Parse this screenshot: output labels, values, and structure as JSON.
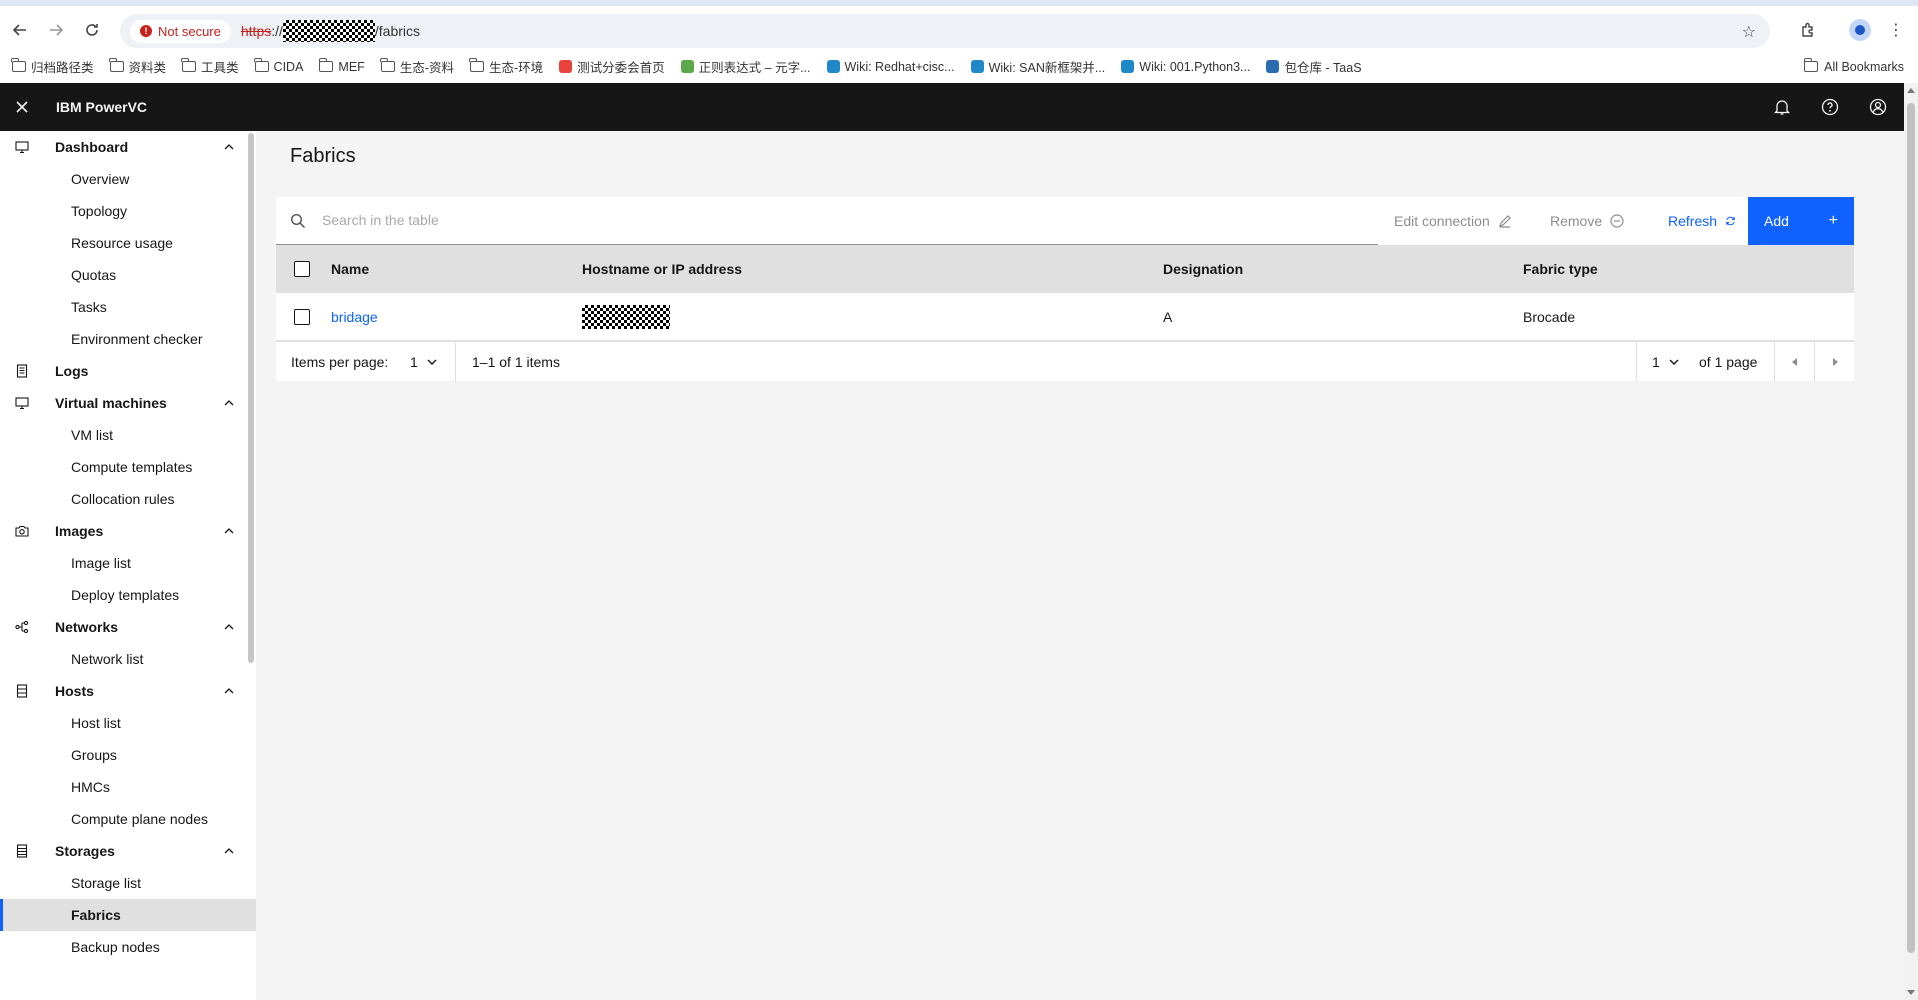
{
  "browser": {
    "not_secure_label": "Not secure",
    "url_scheme": "https",
    "url_sep": "://",
    "url_path": "/fabrics",
    "bookmarks": [
      {
        "label": "归档路径类",
        "type": "folder"
      },
      {
        "label": "资料类",
        "type": "folder"
      },
      {
        "label": "工具类",
        "type": "folder"
      },
      {
        "label": "CIDA",
        "type": "folder"
      },
      {
        "label": "MEF",
        "type": "folder"
      },
      {
        "label": "生态-资料",
        "type": "folder"
      },
      {
        "label": "生态-环境",
        "type": "folder"
      },
      {
        "label": "测试分委会首页",
        "type": "site",
        "color": "#e8423a"
      },
      {
        "label": "正则表达式 – 元字...",
        "type": "site",
        "color": "#5aa848"
      },
      {
        "label": "Wiki: Redhat+cisc...",
        "type": "site",
        "color": "#1e88c9"
      },
      {
        "label": "Wiki: SAN新框架并...",
        "type": "site",
        "color": "#1e88c9"
      },
      {
        "label": "Wiki: 001.Python3...",
        "type": "site",
        "color": "#1e88c9"
      },
      {
        "label": "包仓库 - TaaS",
        "type": "site",
        "color": "#2b6cb0"
      }
    ],
    "all_bookmarks_label": "All Bookmarks"
  },
  "app": {
    "title": "IBM PowerVC"
  },
  "sidebar": {
    "groups": [
      {
        "label": "Dashboard",
        "icon": "monitor-icon",
        "items": [
          "Overview",
          "Topology",
          "Resource usage",
          "Quotas",
          "Tasks",
          "Environment checker"
        ]
      },
      {
        "label": "Logs",
        "icon": "document-icon",
        "items": []
      },
      {
        "label": "Virtual machines",
        "icon": "monitor-icon",
        "items": [
          "VM list",
          "Compute templates",
          "Collocation rules"
        ]
      },
      {
        "label": "Images",
        "icon": "camera-icon",
        "items": [
          "Image list",
          "Deploy templates"
        ]
      },
      {
        "label": "Networks",
        "icon": "network-icon",
        "items": [
          "Network list"
        ]
      },
      {
        "label": "Hosts",
        "icon": "server-icon",
        "items": [
          "Host list",
          "Groups",
          "HMCs",
          "Compute plane nodes"
        ]
      },
      {
        "label": "Storages",
        "icon": "storage-icon",
        "items": [
          "Storage list",
          "Fabrics",
          "Backup nodes"
        ]
      }
    ],
    "active_item": "Fabrics"
  },
  "page": {
    "title": "Fabrics"
  },
  "toolbar": {
    "search_placeholder": "Search in the table",
    "edit_label": "Edit connection",
    "remove_label": "Remove",
    "refresh_label": "Refresh",
    "add_label": "Add"
  },
  "table": {
    "columns": [
      "Name",
      "Hostname or IP address",
      "Designation",
      "Fabric type"
    ],
    "rows": [
      {
        "name": "bridage",
        "designation": "A",
        "fabric_type": "Brocade"
      }
    ]
  },
  "pagination": {
    "items_per_page_label": "Items per page:",
    "items_per_page_value": "1",
    "range_text": "1–1 of 1 items",
    "page_value": "1",
    "of_pages_text": "of 1 page"
  },
  "colors": {
    "primary": "#0f62fe",
    "header_bg": "#161616",
    "not_secure": "#c5221f"
  }
}
